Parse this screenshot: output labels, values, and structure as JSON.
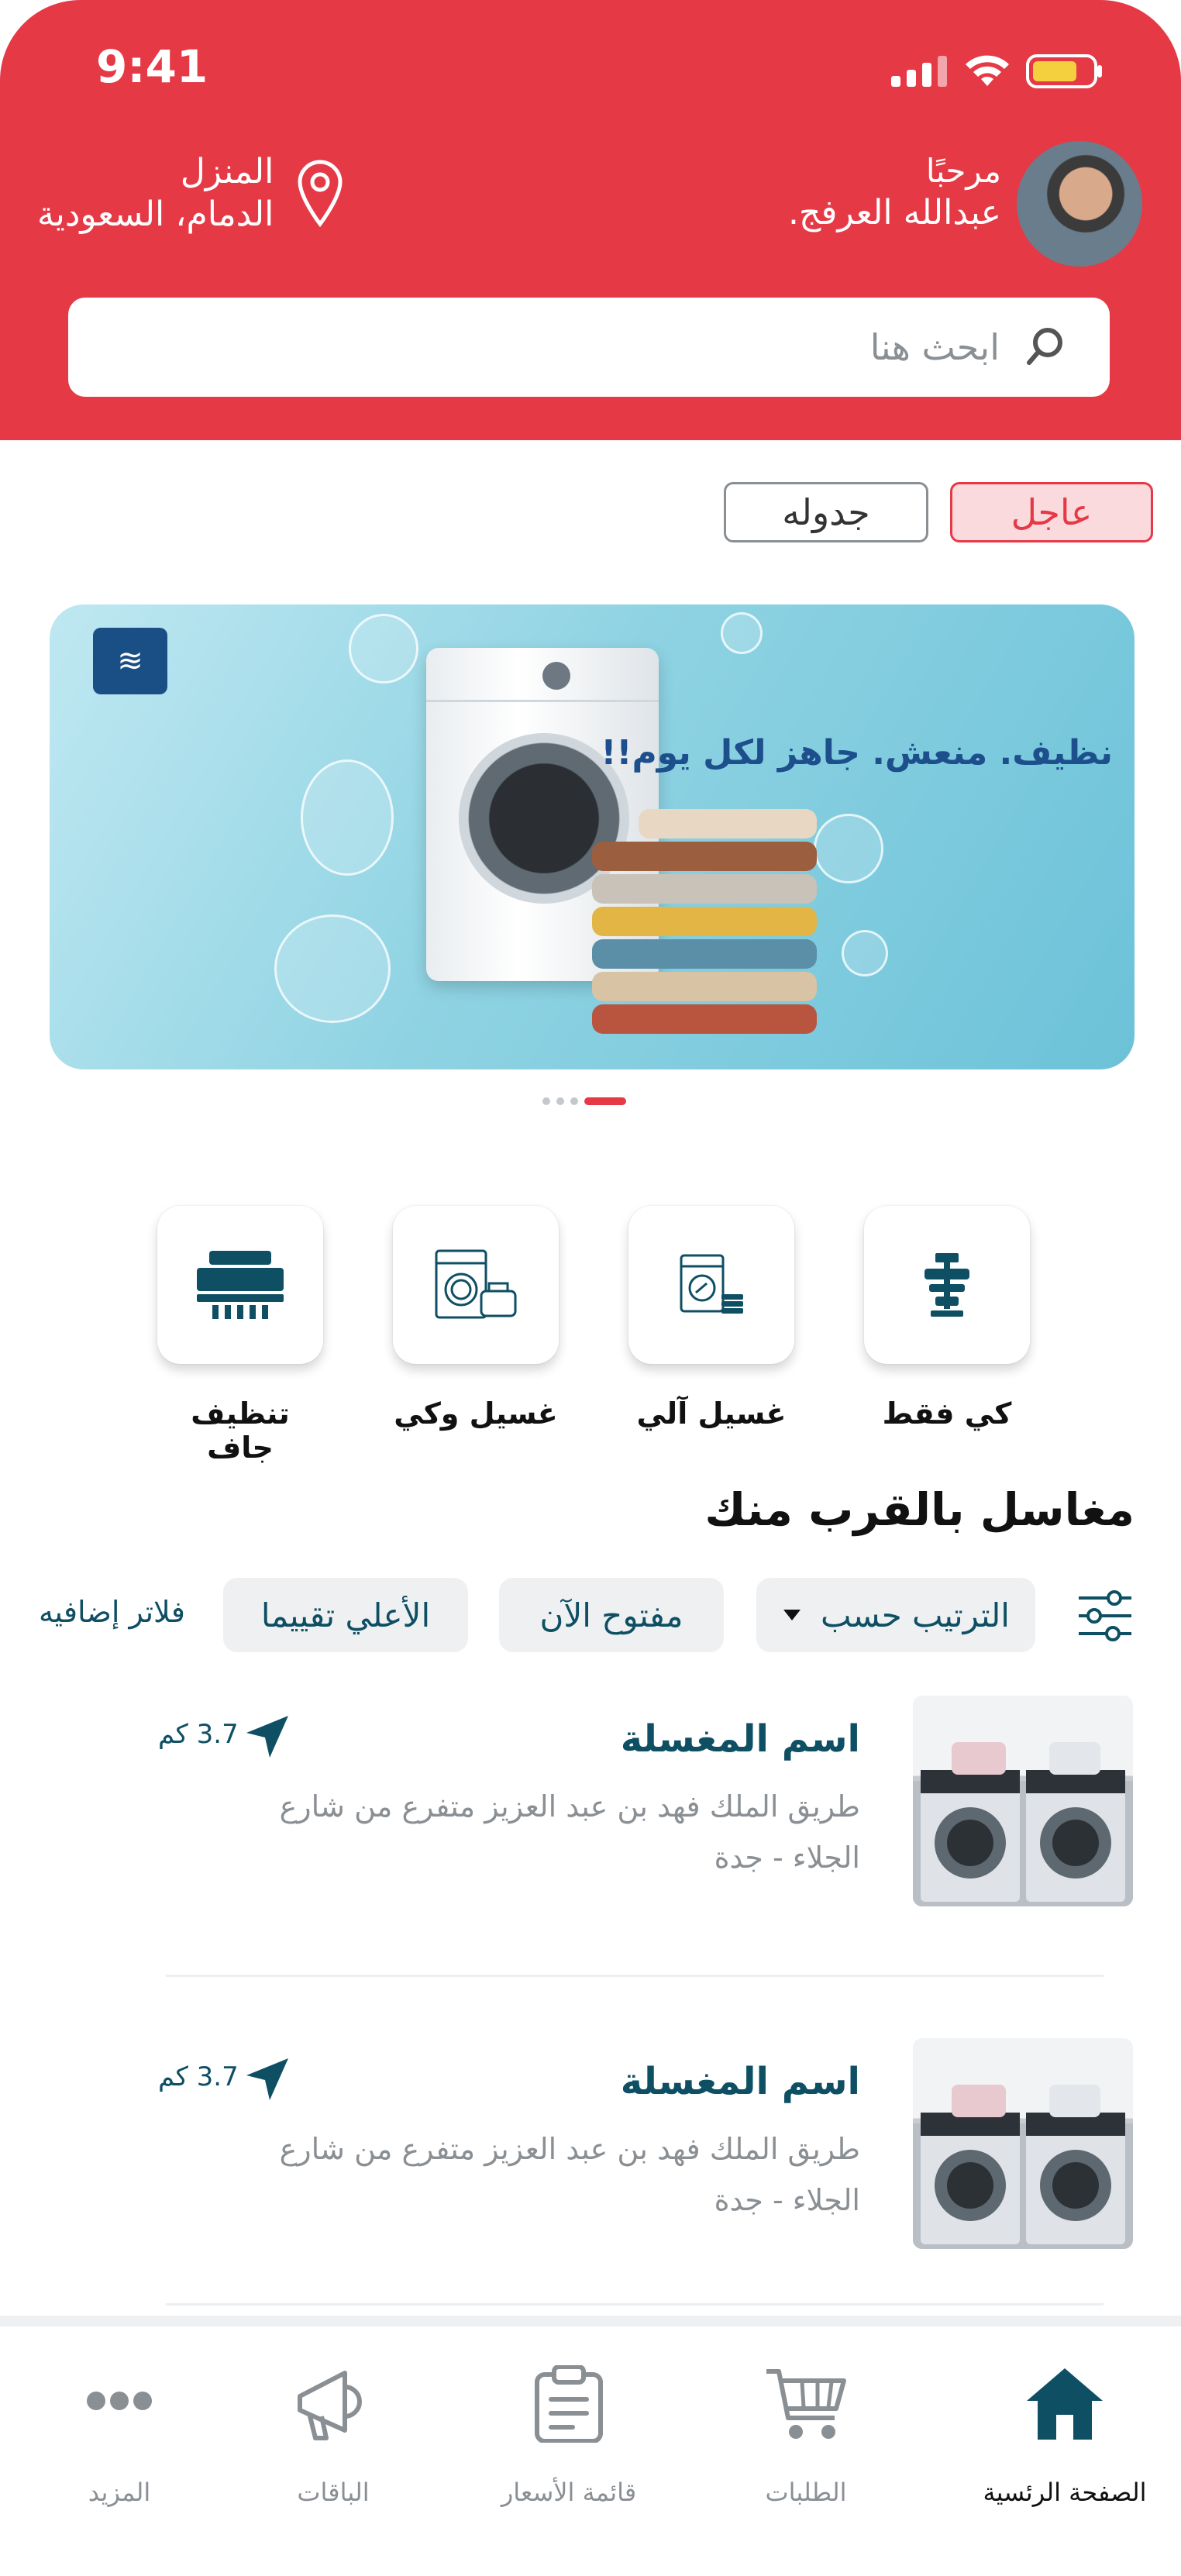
{
  "status_bar": {
    "time": "9:41"
  },
  "header": {
    "greeting": "مرحبًا",
    "user_name": "عبدالله العرفج.",
    "location_label": "المنزل",
    "location_city": "الدمام، السعودية",
    "accent_color": "#e63946"
  },
  "search": {
    "placeholder": "ابحث هنا"
  },
  "order_type": {
    "urgent": "عاجل",
    "scheduled": "جدوله",
    "selected": "urgent"
  },
  "banner": {
    "tagline": "نظيف. منعش. جاهز لكل يوم!!",
    "slide_count": 4,
    "active_slide": 4
  },
  "services": [
    {
      "label": "كي فقط",
      "icon": "iron-icon"
    },
    {
      "label": "غسيل آلي",
      "icon": "washing-machine-icon"
    },
    {
      "label": "غسيل وكي",
      "icon": "wash-and-iron-icon"
    },
    {
      "label": "تنظيف جاف",
      "icon": "dry-cleaning-icon"
    }
  ],
  "nearby": {
    "title": "مغاسل بالقرب منك",
    "filters": {
      "sort": "الترتيب حسب",
      "open_now": "مفتوح الآن",
      "top_rated": "الأعلي تقييما",
      "more": "فلاتر إضافيه"
    },
    "laundries": [
      {
        "name": "اسم المغسلة",
        "address_line1": "طريق الملك فهد بن عبد العزيز متفرع من شارع",
        "address_line2": "الجلاء - جدة",
        "distance": "3.7 كم"
      },
      {
        "name": "اسم المغسلة",
        "address_line1": "طريق الملك فهد بن عبد العزيز متفرع من شارع",
        "address_line2": "الجلاء - جدة",
        "distance": "3.7 كم"
      }
    ]
  },
  "bottom_nav": {
    "home": "الصفحة الرئسية",
    "orders": "الطلبات",
    "price_list": "قائمة الأسعار",
    "packages": "الباقات",
    "more": "المزيد",
    "active": "home",
    "active_color": "#0e4f63"
  }
}
